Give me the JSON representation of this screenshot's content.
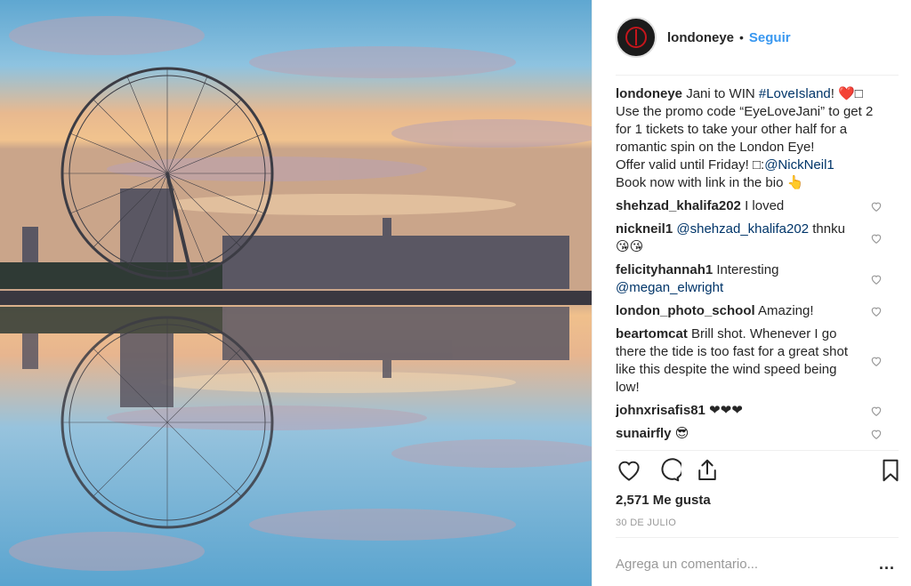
{
  "post": {
    "username": "londoneye",
    "separator": "•",
    "follow_label": "Seguir",
    "caption_user": "londoneye",
    "caption_parts": [
      "Jani to WIN ",
      "#LoveIsland",
      "! ❤️□\nUse the promo code “EyeLoveJani” to get 2 for 1 tickets to take your other half for a romantic spin on the London Eye!\nOffer valid until Friday! □:",
      "@NickNeil1",
      "\nBook now with link in the bio 👆"
    ],
    "likes_text": "2,571 Me gusta",
    "date_text": "30 DE JULIO",
    "comment_placeholder": "Agrega un comentario...",
    "more_label": "..."
  },
  "comments": [
    {
      "user": "shehzad_khalifa202",
      "pre": " I loved",
      "mention": "",
      "post": ""
    },
    {
      "user": "nickneil1",
      "pre": " ",
      "mention": "@shehzad_khalifa202",
      "post": " thnku 😘😘"
    },
    {
      "user": "felicityhannah1",
      "pre": " Interesting ",
      "mention": "@megan_elwright",
      "post": ""
    },
    {
      "user": "london_photo_school",
      "pre": " Amazing!",
      "mention": "",
      "post": ""
    },
    {
      "user": "beartomcat",
      "pre": " Brill shot. Whenever I go there the tide is too fast for a great shot like this despite the wind speed being low!",
      "mention": "",
      "post": ""
    },
    {
      "user": "johnxrisafis81",
      "pre": " ❤❤❤",
      "mention": "",
      "post": ""
    },
    {
      "user": "sunairfly",
      "pre": " 😎",
      "mention": "",
      "post": ""
    }
  ],
  "icons": {
    "like": "heart-outline-icon",
    "comment": "speech-bubble-icon",
    "share": "share-upload-icon",
    "save": "bookmark-icon",
    "comment_like": "small-heart-icon"
  },
  "colors": {
    "follow": "#3897f0",
    "link": "#003569",
    "muted": "#999999",
    "text": "#262626"
  }
}
